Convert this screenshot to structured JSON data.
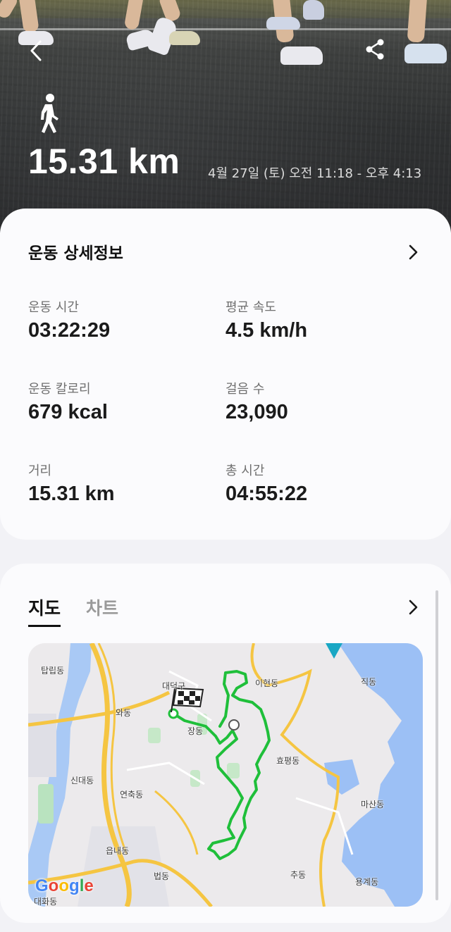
{
  "header": {
    "distance": "15.31 km",
    "date_range": "4월 27일 (토) 오전 11:18 - 오후 4:13",
    "activity_icon": "walking-person-icon"
  },
  "details": {
    "title": "운동 상세정보",
    "stats": [
      {
        "label": "운동 시간",
        "value": "03:22:29"
      },
      {
        "label": "평균 속도",
        "value": "4.5 km/h"
      },
      {
        "label": "운동 칼로리",
        "value": "679 kcal"
      },
      {
        "label": "걸음 수",
        "value": "23,090"
      },
      {
        "label": "거리",
        "value": "15.31 km"
      },
      {
        "label": "총 시간",
        "value": "04:55:22"
      }
    ]
  },
  "map_section": {
    "tabs": [
      {
        "label": "지도",
        "active": true
      },
      {
        "label": "차트",
        "active": false
      }
    ],
    "places": [
      "탑립동",
      "대덕구",
      "와동",
      "장동",
      "이현동",
      "직동",
      "효평동",
      "신대동",
      "연축동",
      "마산동",
      "읍내동",
      "법동",
      "추동",
      "용계동",
      "대화동"
    ],
    "logo": "Google",
    "route_color": "#1fbf3a"
  }
}
